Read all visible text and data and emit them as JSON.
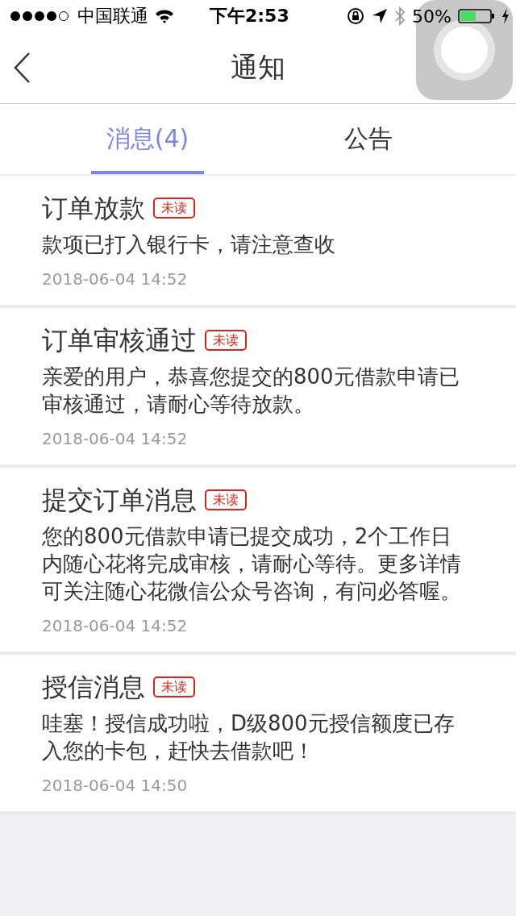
{
  "status_bar": {
    "carrier": "中国联通",
    "time": "下午2:53",
    "battery": "50%"
  },
  "nav": {
    "title": "通知"
  },
  "tabs": [
    {
      "label": "消息(4)",
      "selected": true
    },
    {
      "label": "公告",
      "selected": false
    }
  ],
  "messages": [
    {
      "title": "订单放款",
      "badge": "未读",
      "body": "款项已打入银行卡，请注意查收",
      "time": "2018-06-04 14:52"
    },
    {
      "title": "订单审核通过",
      "badge": "未读",
      "body": "亲爱的用户，恭喜您提交的800元借款申请已审核通过，请耐心等待放款。",
      "time": "2018-06-04 14:52"
    },
    {
      "title": "提交订单消息",
      "badge": "未读",
      "body": "您的800元借款申请已提交成功，2个工作日内随心花将完成审核，请耐心等待。更多详情可关注随心花微信公众号咨询，有问必答喔。",
      "time": "2018-06-04 14:52"
    },
    {
      "title": "授信消息",
      "badge": "未读",
      "body": "哇塞！授信成功啦，D级800元授信额度已存入您的卡包，赶快去借款吧！",
      "time": "2018-06-04 14:50"
    }
  ]
}
